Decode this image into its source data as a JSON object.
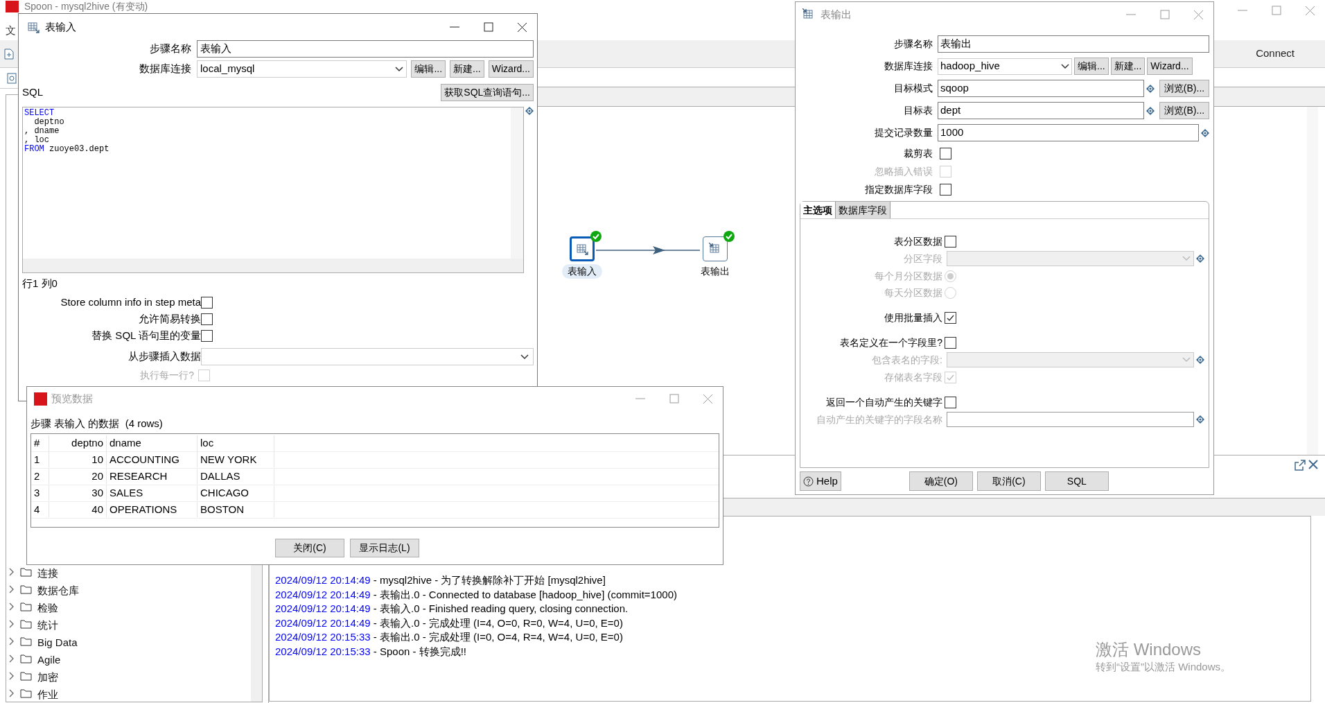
{
  "main_window": {
    "title": "Spoon - mysql2hive (有变动)",
    "menu_fragment": "文",
    "connect_label": "Connect"
  },
  "tree": {
    "items": [
      {
        "label": "连接"
      },
      {
        "label": "数据仓库"
      },
      {
        "label": "检验"
      },
      {
        "label": "统计"
      },
      {
        "label": "Big Data"
      },
      {
        "label": "Agile"
      },
      {
        "label": "加密"
      },
      {
        "label": "作业"
      }
    ]
  },
  "canvas": {
    "steps": [
      {
        "label": "表输入",
        "kind": "input",
        "selected": true,
        "ok": true
      },
      {
        "label": "表输出",
        "kind": "output",
        "selected": false,
        "ok": true
      }
    ]
  },
  "log": {
    "lines": [
      {
        "time": "2024/09/12 20:14:49",
        "text": " - mysql2hive - 为了转换解除补丁开始  [mysql2hive]"
      },
      {
        "time": "2024/09/12 20:14:49",
        "text": " - 表输出.0 - Connected to database [hadoop_hive] (commit=1000)"
      },
      {
        "time": "2024/09/12 20:14:49",
        "text": " - 表输入.0 - Finished reading query, closing connection."
      },
      {
        "time": "2024/09/12 20:14:49",
        "text": " - 表输入.0 - 完成处理 (I=4, O=0, R=0, W=4, U=0, E=0)"
      },
      {
        "time": "2024/09/12 20:15:33",
        "text": " - 表输出.0 - 完成处理 (I=0, O=4, R=4, W=4, U=0, E=0)"
      },
      {
        "time": "2024/09/12 20:15:33",
        "text": " - Spoon - 转换完成!!"
      }
    ]
  },
  "activation": {
    "title": "激活 Windows",
    "subtitle": "转到“设置”以激活 Windows。"
  },
  "table_input_dialog": {
    "title": "表输入",
    "step_name": {
      "label": "步骤名称",
      "value": "表输入"
    },
    "connection": {
      "label": "数据库连接",
      "value": "local_mysql",
      "buttons": [
        "编辑...",
        "新建...",
        "Wizard..."
      ]
    },
    "sql_label": "SQL",
    "get_sql_button": "获取SQL查询语句...",
    "sql_lines": [
      [
        {
          "text": "SELECT",
          "keyword": true
        }
      ],
      [
        {
          "text": "  deptno",
          "keyword": false
        }
      ],
      [
        {
          "text": ", dname",
          "keyword": false
        }
      ],
      [
        {
          "text": ", loc",
          "keyword": false
        }
      ],
      [
        {
          "text": "FROM",
          "keyword": true
        },
        {
          "text": " zuoye03.dept",
          "keyword": false
        }
      ]
    ],
    "cursor_position": "行1 列0",
    "options": [
      {
        "label": "Store column info in step meta",
        "checked": false,
        "disabled": false
      },
      {
        "label": "允许简易转换",
        "checked": false,
        "disabled": false
      },
      {
        "label": "替换 SQL 语句里的变量",
        "checked": false,
        "disabled": false
      }
    ],
    "insert_from_step": {
      "label": "从步骤插入数据"
    },
    "execute_each_row": {
      "label": "执行每一行?",
      "checked": false,
      "disabled": true
    }
  },
  "table_output_dialog": {
    "title": "表输出",
    "fields": [
      {
        "label": "步骤名称",
        "value": "表输出",
        "kind": "text"
      },
      {
        "label": "数据库连接",
        "value": "hadoop_hive",
        "kind": "connection",
        "buttons": [
          "编辑...",
          "新建...",
          "Wizard..."
        ]
      },
      {
        "label": "目标模式",
        "value": "sqoop",
        "kind": "browse",
        "button": "浏览(B)..."
      },
      {
        "label": "目标表",
        "value": "dept",
        "kind": "browse",
        "button": "浏览(B)..."
      },
      {
        "label": "提交记录数量",
        "value": "1000",
        "kind": "variable"
      }
    ],
    "options": [
      {
        "label": "裁剪表",
        "checked": false,
        "disabled": false
      },
      {
        "label": "忽略插入错误",
        "checked": false,
        "disabled": true
      },
      {
        "label": "指定数据库字段",
        "checked": false,
        "disabled": false
      }
    ],
    "tabs": [
      {
        "label": "主选项",
        "selected": true
      },
      {
        "label": "数据库字段",
        "selected": false
      }
    ],
    "main_options": [
      {
        "kind": "checkbox",
        "label": "表分区数据",
        "checked": false,
        "disabled": false
      },
      {
        "kind": "dropdown",
        "label": "分区字段",
        "disabled": true
      },
      {
        "kind": "radio",
        "label": "每个月分区数据",
        "selected": true,
        "disabled": true
      },
      {
        "kind": "radio",
        "label": "每天分区数据",
        "selected": false,
        "disabled": true
      },
      {
        "kind": "checkbox",
        "label": "使用批量插入",
        "checked": true,
        "disabled": false
      },
      {
        "kind": "checkbox",
        "label": "表名定义在一个字段里?",
        "checked": false,
        "disabled": false
      },
      {
        "kind": "dropdown",
        "label": "包含表名的字段:",
        "disabled": true
      },
      {
        "kind": "checkbox",
        "label": "存储表名字段",
        "checked": true,
        "disabled": true
      },
      {
        "kind": "checkbox",
        "label": "返回一个自动产生的关键字",
        "checked": false,
        "disabled": false
      },
      {
        "kind": "text",
        "label": "自动产生的关键字的字段名称",
        "disabled": true
      }
    ],
    "help_button": "Help",
    "buttons": [
      "确定(O)",
      "取消(C)",
      "SQL"
    ]
  },
  "preview_dialog": {
    "title": "预览数据",
    "caption": "步骤 表输入 的数据  (4 rows)",
    "columns": [
      "#",
      "deptno",
      "dname",
      "loc"
    ],
    "rows": [
      [
        "1",
        "10",
        "ACCOUNTING",
        "NEW YORK"
      ],
      [
        "2",
        "20",
        "RESEARCH",
        "DALLAS"
      ],
      [
        "3",
        "30",
        "SALES",
        "CHICAGO"
      ],
      [
        "4",
        "40",
        "OPERATIONS",
        "BOSTON"
      ]
    ],
    "buttons": [
      "关闭(C)",
      "显示日志(L)"
    ]
  }
}
